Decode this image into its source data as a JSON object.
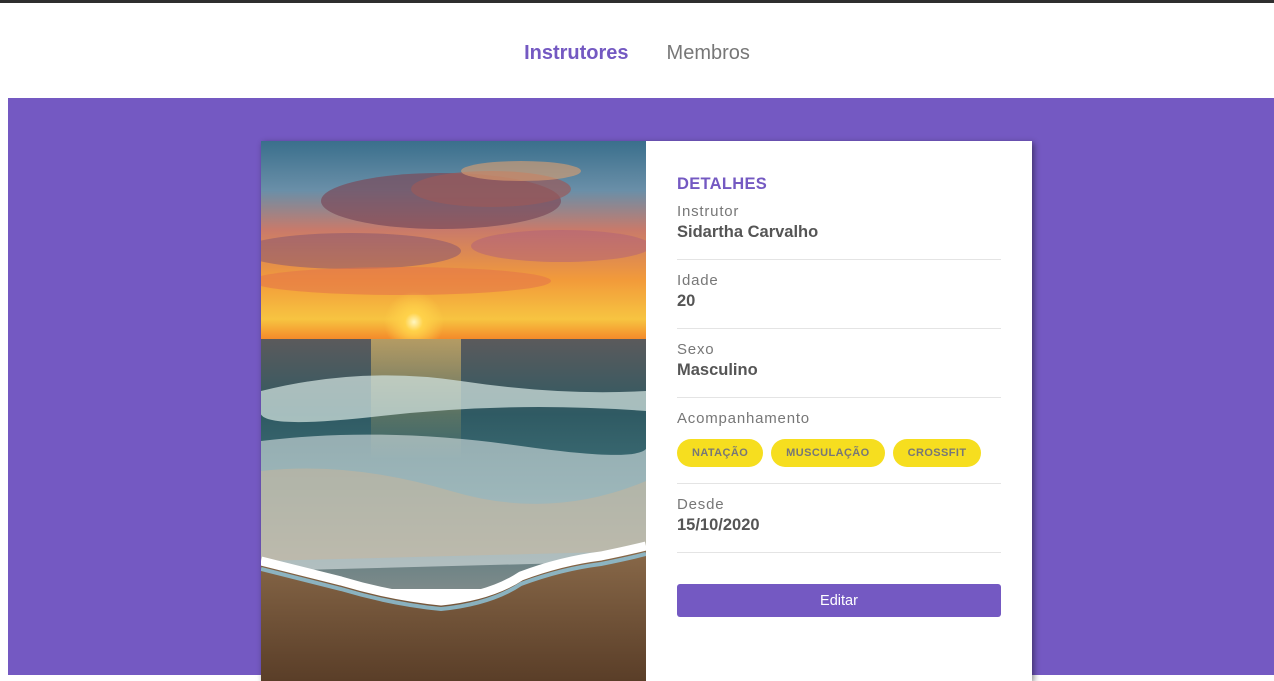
{
  "nav": {
    "items": [
      {
        "label": "Instrutores",
        "active": true
      },
      {
        "label": "Membros",
        "active": false
      }
    ]
  },
  "theme": {
    "accent": "#7459c2",
    "tag_bg": "#f6de1f"
  },
  "card": {
    "image_icon": "sunset-beach-photo",
    "heading": "DETALHES",
    "fields": [
      {
        "label": "Instrutor",
        "value": "Sidartha Carvalho"
      },
      {
        "label": "Idade",
        "value": "20"
      },
      {
        "label": "Sexo",
        "value": "Masculino"
      }
    ],
    "services": {
      "label": "Acompanhamento",
      "tags": [
        "NATAÇÃO",
        "MUSCULAÇÃO",
        "CROSSFIT"
      ]
    },
    "since": {
      "label": "Desde",
      "value": "15/10/2020"
    },
    "edit_label": "Editar"
  }
}
